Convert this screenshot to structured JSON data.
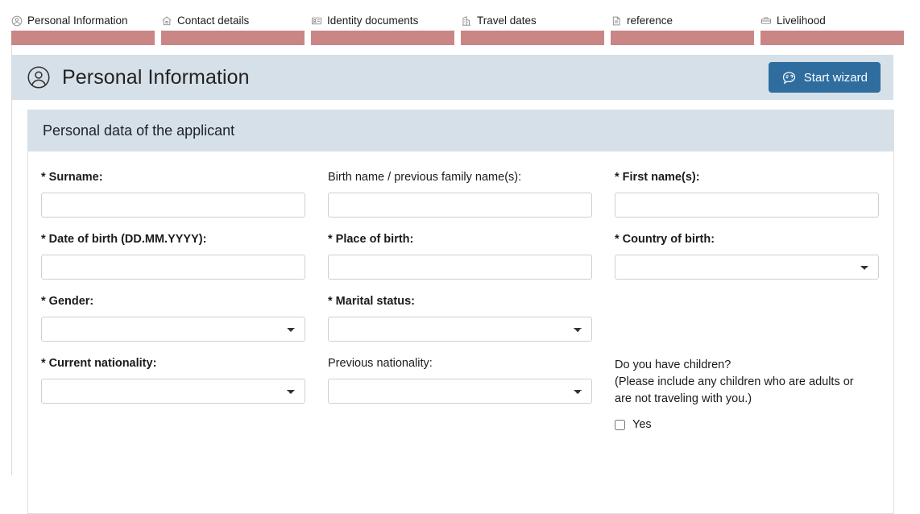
{
  "steps": [
    {
      "label": "Personal Information",
      "icon": "person-circle-icon",
      "active": true
    },
    {
      "label": "Contact details",
      "icon": "home-icon",
      "active": false
    },
    {
      "label": "Identity documents",
      "icon": "id-card-icon",
      "active": false
    },
    {
      "label": "Travel dates",
      "icon": "calendar-building-icon",
      "active": false
    },
    {
      "label": "reference",
      "icon": "document-icon",
      "active": false
    },
    {
      "label": "Livelihood",
      "icon": "briefcase-icon",
      "active": false
    }
  ],
  "header": {
    "title": "Personal Information",
    "icon": "person-circle-icon",
    "wizard_button": "Start wizard",
    "wizard_icon": "speech-bubble-question-icon"
  },
  "panel": {
    "section_title": "Personal data of the applicant",
    "fields": {
      "surname": {
        "label": "* Surname:",
        "value": "",
        "type": "text"
      },
      "birth_name": {
        "label": "Birth name / previous family name(s):",
        "value": "",
        "type": "text"
      },
      "first_names": {
        "label": "* First name(s):",
        "value": "",
        "type": "text"
      },
      "date_of_birth": {
        "label": "* Date of birth (DD.MM.YYYY):",
        "value": "",
        "type": "text"
      },
      "place_of_birth": {
        "label": "* Place of birth:",
        "value": "",
        "type": "text"
      },
      "country_of_birth": {
        "label": "* Country of birth:",
        "value": "",
        "type": "select",
        "options": [
          ""
        ]
      },
      "gender": {
        "label": "* Gender:",
        "value": "",
        "type": "select",
        "options": [
          ""
        ]
      },
      "marital_status": {
        "label": "* Marital status:",
        "value": "",
        "type": "select",
        "options": [
          ""
        ]
      },
      "current_nationality": {
        "label": "* Current nationality:",
        "value": "",
        "type": "select",
        "options": [
          ""
        ]
      },
      "previous_nationality": {
        "label": "Previous nationality:",
        "value": "",
        "type": "select",
        "options": [
          ""
        ]
      }
    },
    "children_question": {
      "text": "Do you have children?\n(Please include any children who are adults or\nare not traveling with you.)",
      "checkbox_label": "Yes",
      "checked": false
    }
  },
  "colors": {
    "step_bar": "#ca8585",
    "header_band": "#d6e0e8",
    "accent_button": "#2f6d9e",
    "panel_border": "#e0e0e0"
  }
}
